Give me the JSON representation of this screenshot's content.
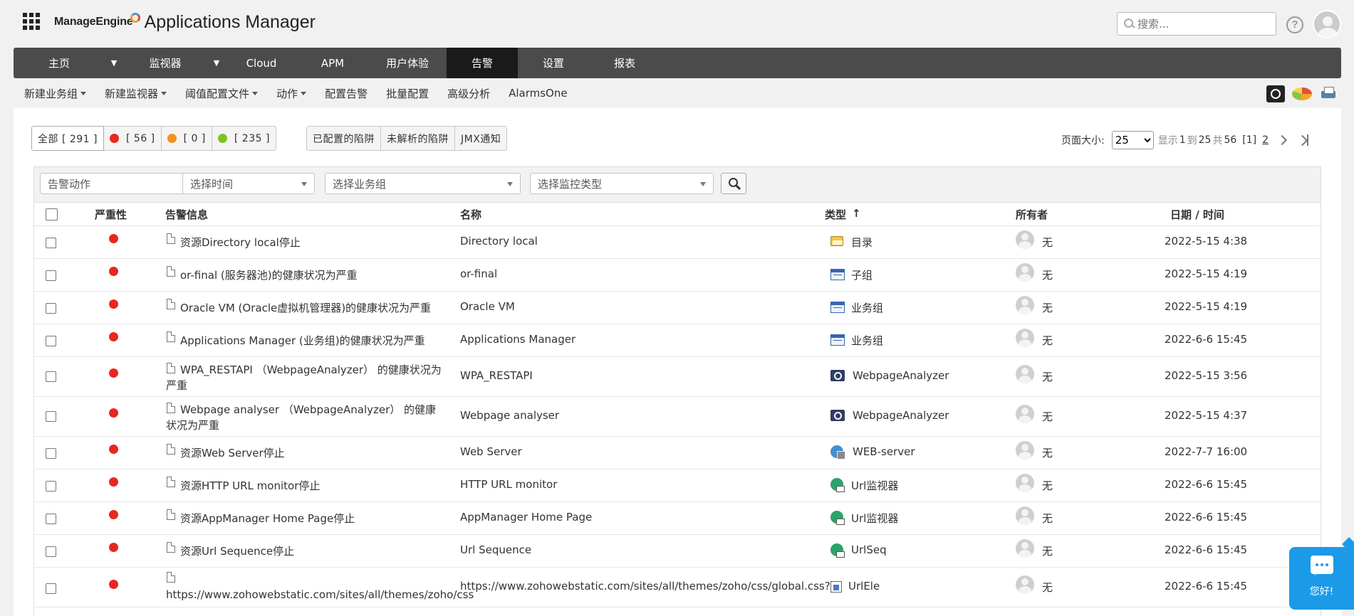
{
  "header": {
    "brand": "ManageEngine",
    "product": "Applications Manager",
    "search_placeholder": "搜索...",
    "help_label": "?"
  },
  "nav": {
    "items": [
      {
        "label": "主页",
        "dropdown": true
      },
      {
        "label": "监视器",
        "dropdown": true
      },
      {
        "label": "Cloud",
        "dropdown": false
      },
      {
        "label": "APM",
        "dropdown": false
      },
      {
        "label": "用户体验",
        "dropdown": false
      },
      {
        "label": "告警",
        "dropdown": false,
        "active": true
      },
      {
        "label": "设置",
        "dropdown": false
      },
      {
        "label": "报表",
        "dropdown": false
      }
    ]
  },
  "subnav": {
    "items": [
      {
        "label": "新建业务组",
        "dropdown": true
      },
      {
        "label": "新建监视器",
        "dropdown": true
      },
      {
        "label": "阈值配置文件",
        "dropdown": true
      },
      {
        "label": "动作",
        "dropdown": true
      },
      {
        "label": "配置告警",
        "dropdown": false
      },
      {
        "label": "批量配置",
        "dropdown": false
      },
      {
        "label": "高级分析",
        "dropdown": false
      },
      {
        "label": "AlarmsOne",
        "dropdown": false
      }
    ]
  },
  "filters": {
    "all": "全部 [ 291 ]",
    "critical": "[ 56 ]",
    "warning": "[ 0 ]",
    "clear": "[ 235 ]",
    "configured_traps": "已配置的陷阱",
    "unresolved_traps": "未解析的陷阱",
    "jmx": "JMX通知",
    "colors": {
      "critical": "#e8271e",
      "warning": "#f4921d",
      "clear": "#7cc322"
    }
  },
  "pager": {
    "page_size_label": "页面大小:",
    "page_size": "25",
    "show": "显示",
    "from": "1",
    "to_label": "到",
    "to": "25",
    "total_label": "共",
    "total": "56",
    "current": "[1]",
    "next_page": "2"
  },
  "table_filters": {
    "action": "告警动作",
    "time": "选择时间",
    "group": "选择业务组",
    "monitor_type": "选择监控类型"
  },
  "columns": {
    "severity": "严重性",
    "message": "告警信息",
    "name": "名称",
    "type": "类型",
    "sort_arrow": "↑",
    "owner": "所有者",
    "datetime": "日期 / 时间"
  },
  "rows": [
    {
      "message": "资源Directory local停止",
      "name": "Directory local",
      "type": "目录",
      "icon": "folder-icon",
      "owner": "无",
      "datetime": "2022-5-15 4:38"
    },
    {
      "message": "or-final (服务器池)的健康状况为严重",
      "name": "or-final",
      "type": "子组",
      "icon": "group-icon",
      "owner": "无",
      "datetime": "2022-5-15 4:19"
    },
    {
      "message": "Oracle VM (Oracle虚拟机管理器)的健康状况为严重",
      "name": "Oracle VM",
      "type": "业务组",
      "icon": "group-icon",
      "owner": "无",
      "datetime": "2022-5-15 4:19"
    },
    {
      "message": "Applications Manager (业务组)的健康状况为严重",
      "name": "Applications Manager",
      "type": "业务组",
      "icon": "group-icon",
      "owner": "无",
      "datetime": "2022-6-6 15:45"
    },
    {
      "message": "WPA_RESTAPI （WebpageAnalyzer） 的健康状况为严重",
      "name": "WPA_RESTAPI",
      "type": "WebpageAnalyzer",
      "icon": "webpage-analyzer-icon",
      "owner": "无",
      "datetime": "2022-5-15 3:56"
    },
    {
      "message": "Webpage analyser （WebpageAnalyzer） 的健康状况为严重",
      "name": "Webpage analyser",
      "type": "WebpageAnalyzer",
      "icon": "webpage-analyzer-icon",
      "owner": "无",
      "datetime": "2022-5-15 4:37"
    },
    {
      "message": "资源Web Server停止",
      "name": "Web Server",
      "type": "WEB-server",
      "icon": "web-server-icon",
      "owner": "无",
      "datetime": "2022-7-7 16:00"
    },
    {
      "message": "资源HTTP URL monitor停止",
      "name": "HTTP URL monitor",
      "type": "Url监视器",
      "icon": "url-monitor-icon",
      "owner": "无",
      "datetime": "2022-6-6 15:45"
    },
    {
      "message": "资源AppManager Home Page停止",
      "name": "AppManager Home Page",
      "type": "Url监视器",
      "icon": "url-monitor-icon",
      "owner": "无",
      "datetime": "2022-6-6 15:45"
    },
    {
      "message": "资源Url Sequence停止",
      "name": "Url Sequence",
      "type": "UrlSeq",
      "icon": "url-sequence-icon",
      "owner": "无",
      "datetime": "2022-6-6 15:45"
    },
    {
      "message": "https://www.zohowebstatic.com/sites/all/themes/zoho/css",
      "name": "https://www.zohowebstatic.com/sites/all/themes/zoho/css/global.css?",
      "type": "UrlEle",
      "icon": "url-element-icon",
      "owner": "无",
      "datetime": "2022-6-6 15:45"
    }
  ],
  "chat": {
    "label": "您好!"
  }
}
